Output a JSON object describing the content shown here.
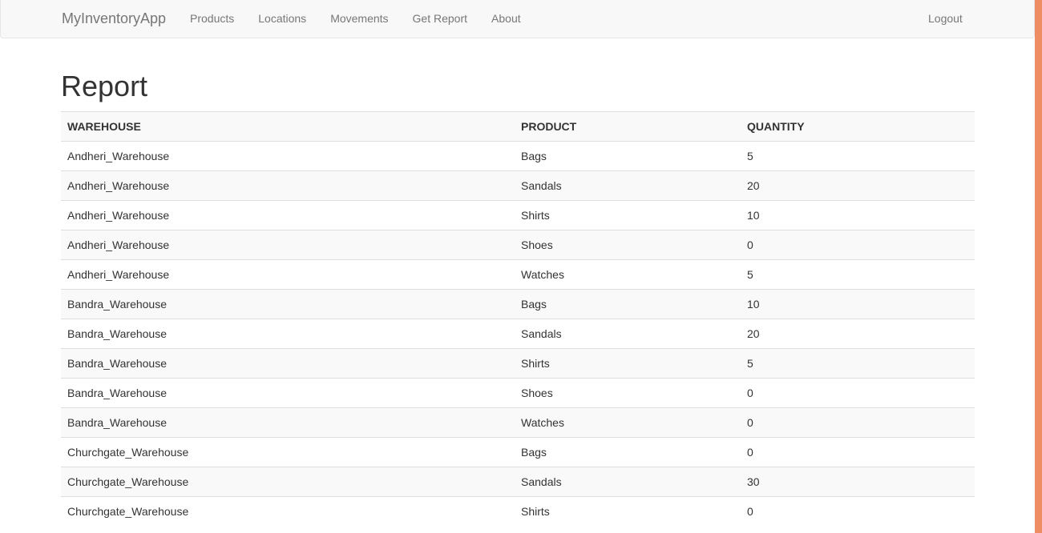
{
  "navbar": {
    "brand": "MyInventoryApp",
    "links": [
      "Products",
      "Locations",
      "Movements",
      "Get Report",
      "About"
    ],
    "logout": "Logout"
  },
  "page": {
    "title": "Report"
  },
  "table": {
    "headers": [
      "WAREHOUSE",
      "PRODUCT",
      "QUANTITY"
    ],
    "rows": [
      [
        "Andheri_Warehouse",
        "Bags",
        "5"
      ],
      [
        "Andheri_Warehouse",
        "Sandals",
        "20"
      ],
      [
        "Andheri_Warehouse",
        "Shirts",
        "10"
      ],
      [
        "Andheri_Warehouse",
        "Shoes",
        "0"
      ],
      [
        "Andheri_Warehouse",
        "Watches",
        "5"
      ],
      [
        "Bandra_Warehouse",
        "Bags",
        "10"
      ],
      [
        "Bandra_Warehouse",
        "Sandals",
        "20"
      ],
      [
        "Bandra_Warehouse",
        "Shirts",
        "5"
      ],
      [
        "Bandra_Warehouse",
        "Shoes",
        "0"
      ],
      [
        "Bandra_Warehouse",
        "Watches",
        "0"
      ],
      [
        "Churchgate_Warehouse",
        "Bags",
        "0"
      ],
      [
        "Churchgate_Warehouse",
        "Sandals",
        "30"
      ],
      [
        "Churchgate_Warehouse",
        "Shirts",
        "0"
      ]
    ]
  },
  "colors": {
    "navbar_bg": "#f8f8f8",
    "nav_text": "#777777",
    "stripe_bg": "#f9f9f9",
    "border": "#dddddd",
    "scroll_accent": "#ee8c63"
  }
}
